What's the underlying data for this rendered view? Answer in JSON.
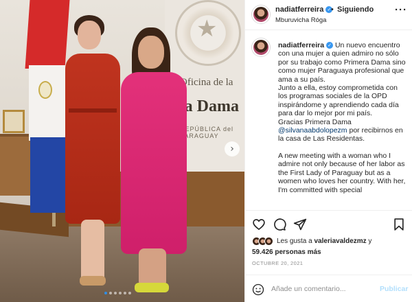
{
  "post": {
    "username": "nadiatferreira",
    "verified_mark": "✓",
    "separator": "•",
    "follow_status": "Siguiendo",
    "location": "Mburuvicha Róga",
    "more_label": "···"
  },
  "photo": {
    "plaque_line1": "Oficina de la",
    "plaque_line2": "ra Dama",
    "plaque_line3": "REPÚBLICA del PARAGUAY",
    "next_label": "›",
    "carousel_count": 6,
    "carousel_active": 0
  },
  "caption": {
    "username": "nadiatferreira",
    "verified_mark": "✓",
    "lines": [
      "Un nuevo encuentro con una mujer a quien admiro no sólo por su trabajo como Primera Dama sino como mujer Paraguaya profesional que ama a su país.",
      "Junto a ella, estoy comprometida con los programas sociales de la OPD inspirándome y aprendiendo cada día para dar lo mejor por mi país.",
      "Gracias Primera Dama"
    ],
    "mention": "@silvanaabdolopezm",
    "mention_suffix": " por recibirnos en la casa de Las Residentas.",
    "english": "A new meeting with a woman who I admire not only because of her labor as the First Lady of Paraguay but as a women who loves her country. With her, I'm committed with special"
  },
  "likes": {
    "prefix": "Les gusta a ",
    "liker": "valeriavaldezmz",
    "connector": " y",
    "count": "59.426 personas más"
  },
  "date": "OCTUBRE 20, 2021",
  "comment": {
    "placeholder": "Añade un comentario...",
    "publish_label": "Publicar"
  },
  "icons": {
    "like": "heart-icon",
    "comment": "comment-icon",
    "share": "share-icon",
    "save": "bookmark-icon",
    "emoji": "emoji-icon"
  }
}
